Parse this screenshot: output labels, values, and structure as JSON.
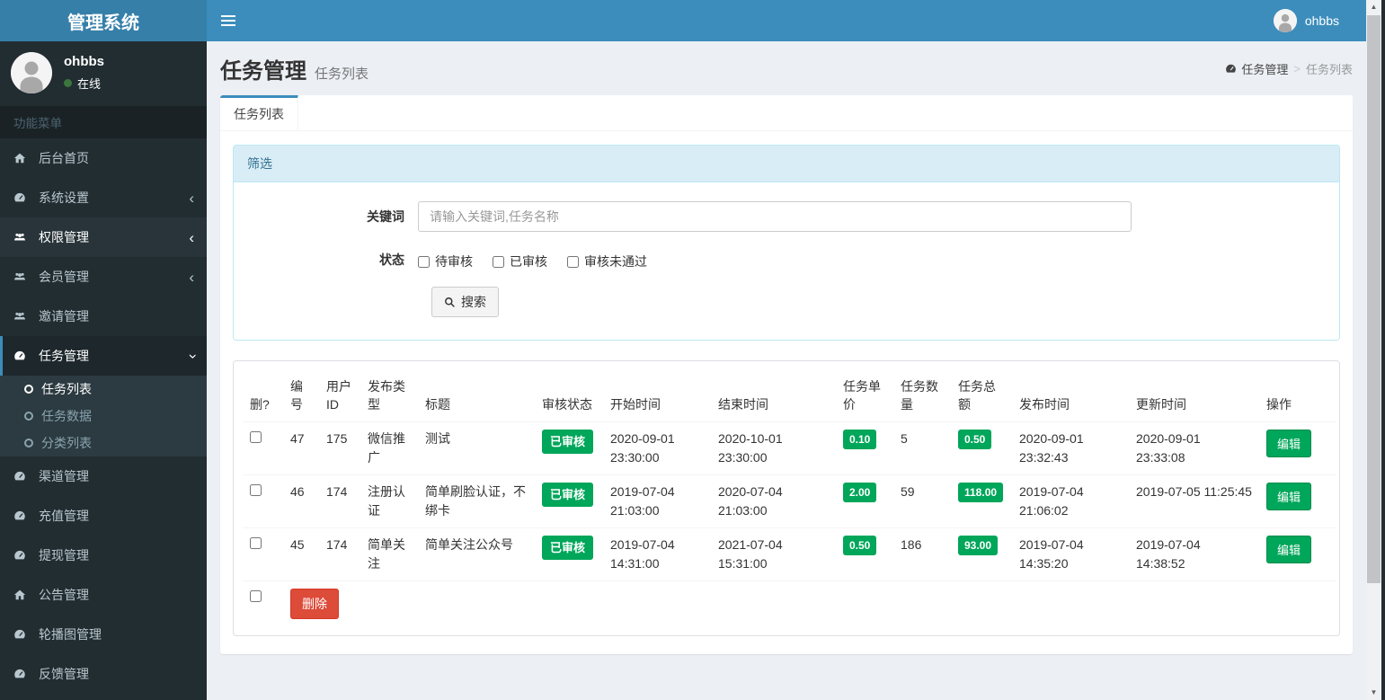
{
  "navbar": {
    "brand": "管理系统",
    "user_name": "ohbbs"
  },
  "sidebar": {
    "user_name": "ohbbs",
    "user_status": "在线",
    "section_label": "功能菜单",
    "items": [
      {
        "label": "后台首页"
      },
      {
        "label": "系统设置"
      },
      {
        "label": "权限管理"
      },
      {
        "label": "会员管理"
      },
      {
        "label": "邀请管理"
      },
      {
        "label": "任务管理"
      },
      {
        "label": "渠道管理"
      },
      {
        "label": "充值管理"
      },
      {
        "label": "提现管理"
      },
      {
        "label": "公告管理"
      },
      {
        "label": "轮播图管理"
      },
      {
        "label": "反馈管理"
      }
    ],
    "submenu": [
      {
        "label": "任务列表"
      },
      {
        "label": "任务数据"
      },
      {
        "label": "分类列表"
      }
    ]
  },
  "page": {
    "title": "任务管理",
    "subtitle": "任务列表"
  },
  "breadcrumb": {
    "parent": "任务管理",
    "separator": ">",
    "current": "任务列表"
  },
  "tab": {
    "label": "任务列表"
  },
  "filter": {
    "header": "筛选",
    "keyword_label": "关键词",
    "keyword_placeholder": "请输入关键词,任务名称",
    "keyword_value": "",
    "status_label": "状态",
    "status_options": [
      {
        "label": "待审核"
      },
      {
        "label": "已审核"
      },
      {
        "label": "审核未通过"
      }
    ],
    "search_label": "搜索"
  },
  "table": {
    "headers": [
      "删?",
      "编号",
      "用户ID",
      "发布类型",
      "标题",
      "审核状态",
      "开始时间",
      "结束时间",
      "任务单价",
      "任务数量",
      "任务总额",
      "发布时间",
      "更新时间",
      "操作"
    ],
    "rows": [
      {
        "id": "47",
        "user_id": "175",
        "type": "微信推广",
        "title": "测试",
        "status": "已审核",
        "start": "2020-09-01 23:30:00",
        "end": "2020-10-01 23:30:00",
        "price": "0.10",
        "qty": "5",
        "total": "0.50",
        "published": "2020-09-01 23:32:43",
        "updated": "2020-09-01 23:33:08",
        "edit_label": "编辑"
      },
      {
        "id": "46",
        "user_id": "174",
        "type": "注册认证",
        "title": "简单刷脸认证，不绑卡",
        "status": "已审核",
        "start": "2019-07-04 21:03:00",
        "end": "2020-07-04 21:03:00",
        "price": "2.00",
        "qty": "59",
        "total": "118.00",
        "published": "2019-07-04 21:06:02",
        "updated": "2019-07-05 11:25:45",
        "edit_label": "编辑"
      },
      {
        "id": "45",
        "user_id": "174",
        "type": "简单关注",
        "title": "简单关注公众号",
        "status": "已审核",
        "start": "2019-07-04 14:31:00",
        "end": "2021-07-04 15:31:00",
        "price": "0.50",
        "qty": "186",
        "total": "93.00",
        "published": "2019-07-04 14:35:20",
        "updated": "2019-07-04 14:38:52",
        "edit_label": "编辑"
      }
    ],
    "delete_label": "删除"
  },
  "colors": {
    "accent": "#3c8dbc",
    "success": "#00a65a",
    "danger": "#dd4b39"
  }
}
